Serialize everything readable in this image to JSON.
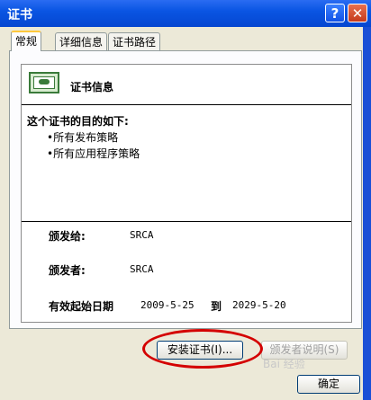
{
  "window": {
    "title": "证书",
    "help_glyph": "?",
    "close_glyph": "✕"
  },
  "tabs": [
    {
      "label": "常规",
      "active": true
    },
    {
      "label": "详细信息",
      "active": false
    },
    {
      "label": "证书路径",
      "active": false
    }
  ],
  "certificate": {
    "info_title": "证书信息",
    "purpose_heading": "这个证书的目的如下:",
    "purposes": [
      "•所有发布策略",
      "•所有应用程序策略"
    ],
    "issued_to_label": "颁发给:",
    "issued_to_value": "SRCA",
    "issued_by_label": "颁发者:",
    "issued_by_value": "SRCA",
    "validity_label": "有效起始日期",
    "valid_from": "2009-5-25",
    "to_label": "到",
    "valid_to": "2029-5-20"
  },
  "buttons": {
    "install_label": "安装证书(I)...",
    "issuer_statement_label": "颁发者说明(S)",
    "ok_label": "确定"
  },
  "annotation": {
    "circle_color": "#d40000"
  },
  "watermark": "Bai 经验"
}
